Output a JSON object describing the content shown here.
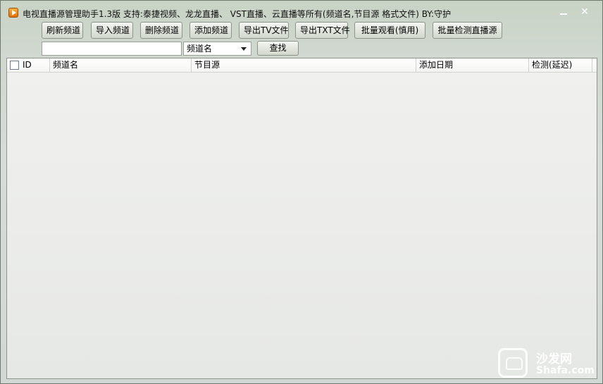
{
  "window": {
    "title": "电视直播源管理助手1.3版  支持:泰捷视频、龙龙直播、 VST直播、云直播等所有(频道名,节目源  格式文件) BY:守护",
    "minimize_label": "",
    "close_label": "✕"
  },
  "toolbar": {
    "buttons": [
      {
        "label": "刷新频道"
      },
      {
        "label": "导入频道"
      },
      {
        "label": "删除频道"
      },
      {
        "label": "添加频道"
      },
      {
        "label": "导出TV文件"
      },
      {
        "label": "导出TXT文件"
      },
      {
        "label": "批量观看(慎用)"
      },
      {
        "label": "批量检测直播源"
      }
    ]
  },
  "search": {
    "value": "",
    "placeholder": "",
    "field_selected": "频道名",
    "find_label": "查找"
  },
  "table": {
    "columns": [
      {
        "label": "ID"
      },
      {
        "label": "频道名"
      },
      {
        "label": "节目源"
      },
      {
        "label": "添加日期"
      },
      {
        "label": "检测(延迟)"
      }
    ],
    "rows": []
  },
  "watermark": {
    "name": "沙发网",
    "domain": "Shafa.com",
    "icon": "sofa-icon"
  }
}
